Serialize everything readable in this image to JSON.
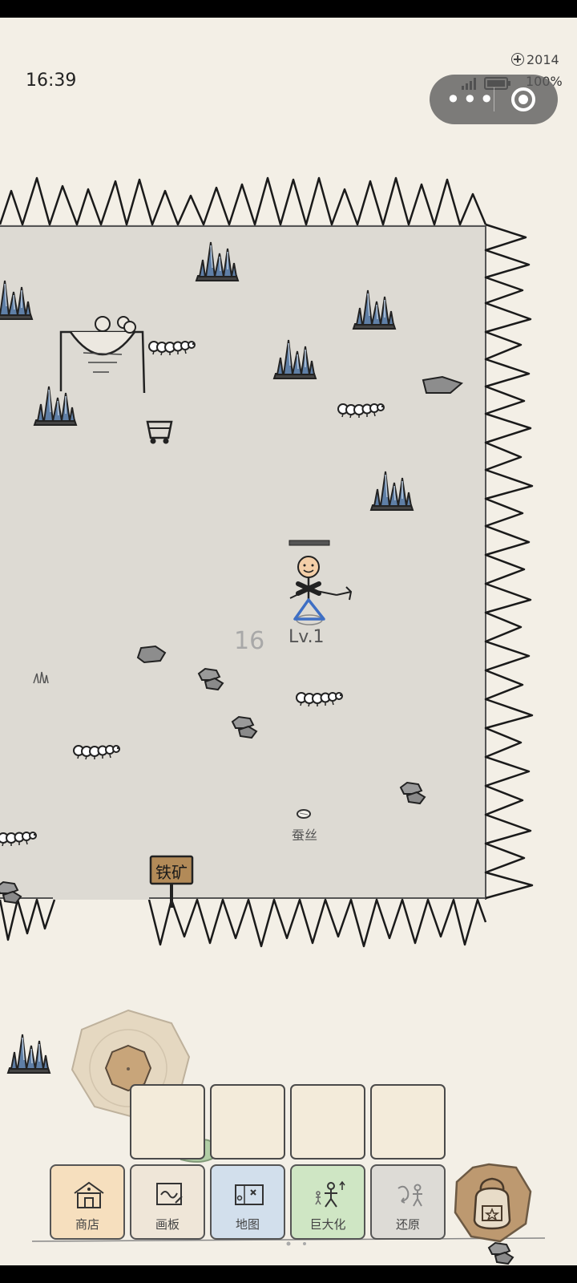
{
  "status_bar": {
    "time": "16:39",
    "battery": "100%"
  },
  "currency": {
    "amount": "2014",
    "icon": "plus-coin-icon"
  },
  "capsule": {
    "more_label": "•••",
    "record_icon": "record-circle-icon"
  },
  "player": {
    "level_label": "Lv.1",
    "damage_number": "16"
  },
  "world_items": {
    "dropped_item_label": "蚕丝",
    "signpost_text": "铁矿"
  },
  "joystick": {
    "icon": "joystick-knob"
  },
  "quick_slots": [
    "",
    "",
    "",
    ""
  ],
  "bottom_menu": [
    {
      "label": "商店",
      "icon": "shop-icon",
      "color": "#f6dfbe"
    },
    {
      "label": "画板",
      "icon": "drawing-board-icon",
      "color": "#efe6d8"
    },
    {
      "label": "地图",
      "icon": "map-icon",
      "color": "#d2dfec"
    },
    {
      "label": "巨大化",
      "icon": "giant-icon",
      "color": "#cfe6c4"
    },
    {
      "label": "还原",
      "icon": "restore-icon",
      "color": "#dddbd6"
    }
  ],
  "backpack": {
    "icon": "backpack-icon"
  },
  "colors": {
    "paper_bg": "#f3efe6",
    "arena_floor": "#dddad3",
    "crystal_blue": "#5f7fa6",
    "ink": "#222222"
  }
}
